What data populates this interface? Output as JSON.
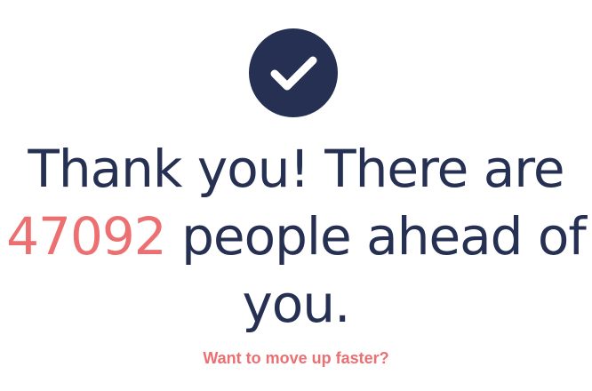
{
  "colors": {
    "navy": "#253052",
    "accent": "#ec6f71",
    "icon_stroke": "#ffffff"
  },
  "success_icon": "checkmark-icon",
  "headline": {
    "line1": "Thank you! There are",
    "count": "47092",
    "line2_rest": "people ahead of",
    "line3": "you."
  },
  "cta": {
    "label": "Want to move up faster?"
  }
}
